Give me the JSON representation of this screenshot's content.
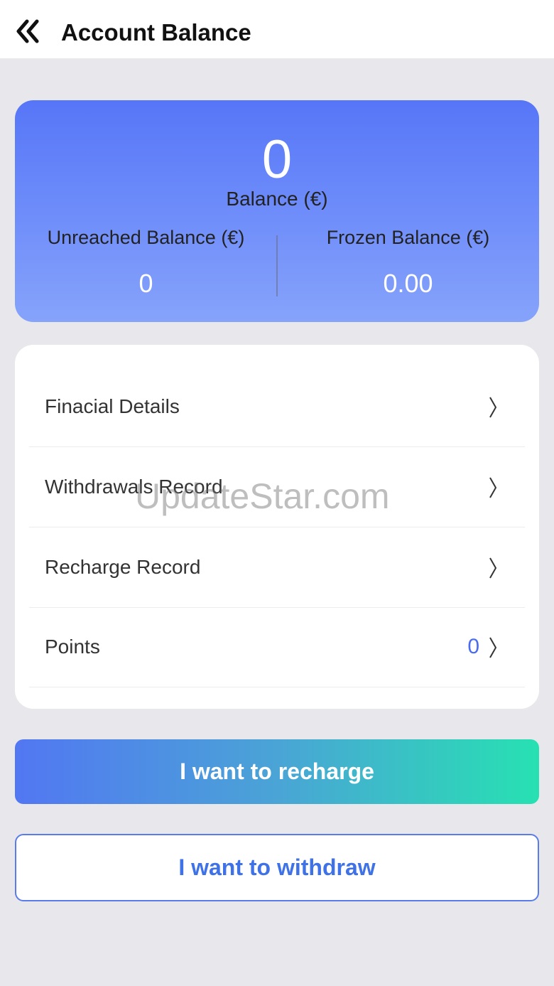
{
  "header": {
    "title": "Account Balance",
    "back_icon": "double-chevron-left-icon"
  },
  "balance_card": {
    "balance_value": "0",
    "balance_label": "Balance (€)",
    "unreached_label": "Unreached Balance (€)",
    "unreached_value": "0",
    "frozen_label": "Frozen Balance (€)",
    "frozen_value": "0.00",
    "gradient_top": "#5676f8",
    "gradient_bottom": "#86a3fb"
  },
  "menu": {
    "items": [
      {
        "label": "Finacial Details"
      },
      {
        "label": "Withdrawals Record"
      },
      {
        "label": "Recharge Record"
      },
      {
        "label": "Points",
        "count": "0"
      }
    ],
    "chevron_icon": "chevron-right-icon"
  },
  "actions": {
    "recharge_label": "I want to recharge",
    "withdraw_label": "I want to withdraw",
    "accent": "#3f72e6"
  },
  "watermark": "UpdateStar.com"
}
